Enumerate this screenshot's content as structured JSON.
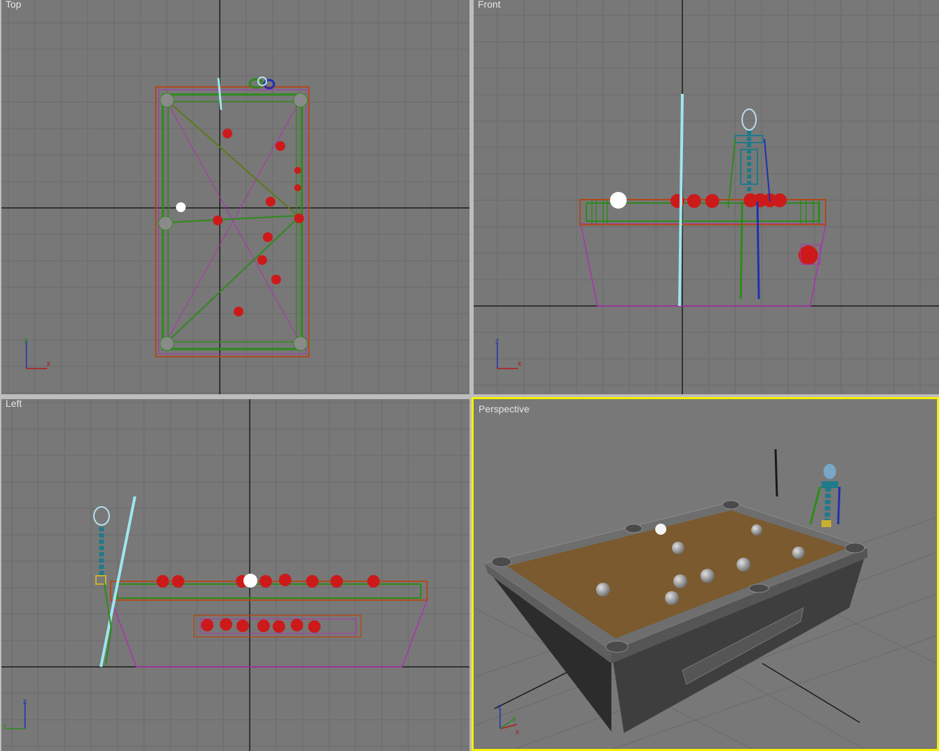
{
  "viewports": {
    "top": {
      "label": "Top"
    },
    "front": {
      "label": "Front"
    },
    "left": {
      "label": "Left"
    },
    "perspective": {
      "label": "Perspective",
      "active": true
    }
  },
  "axis_tripods": {
    "top": [
      "y",
      "x"
    ],
    "front": [
      "z",
      "x"
    ],
    "left": [
      "z",
      "y"
    ],
    "perspective": [
      "z",
      "x",
      "y"
    ]
  },
  "colors": {
    "viewport_bg": "#787878",
    "grid_line": "#6a6a6a",
    "world_axis": "#1a1a1a",
    "active_border": "#f3f000",
    "table_frame": "#b04a1a",
    "table_inner": "#2d8a1a",
    "table_trim": "#b030b0",
    "ball_red": "#cc1a1a",
    "cue_ball": "#ffffff",
    "cue_stick": "#9fe6ee",
    "skeleton": "#1f7a8a",
    "felt": "#7a5a2e",
    "table_body": "#3a3a3a"
  }
}
